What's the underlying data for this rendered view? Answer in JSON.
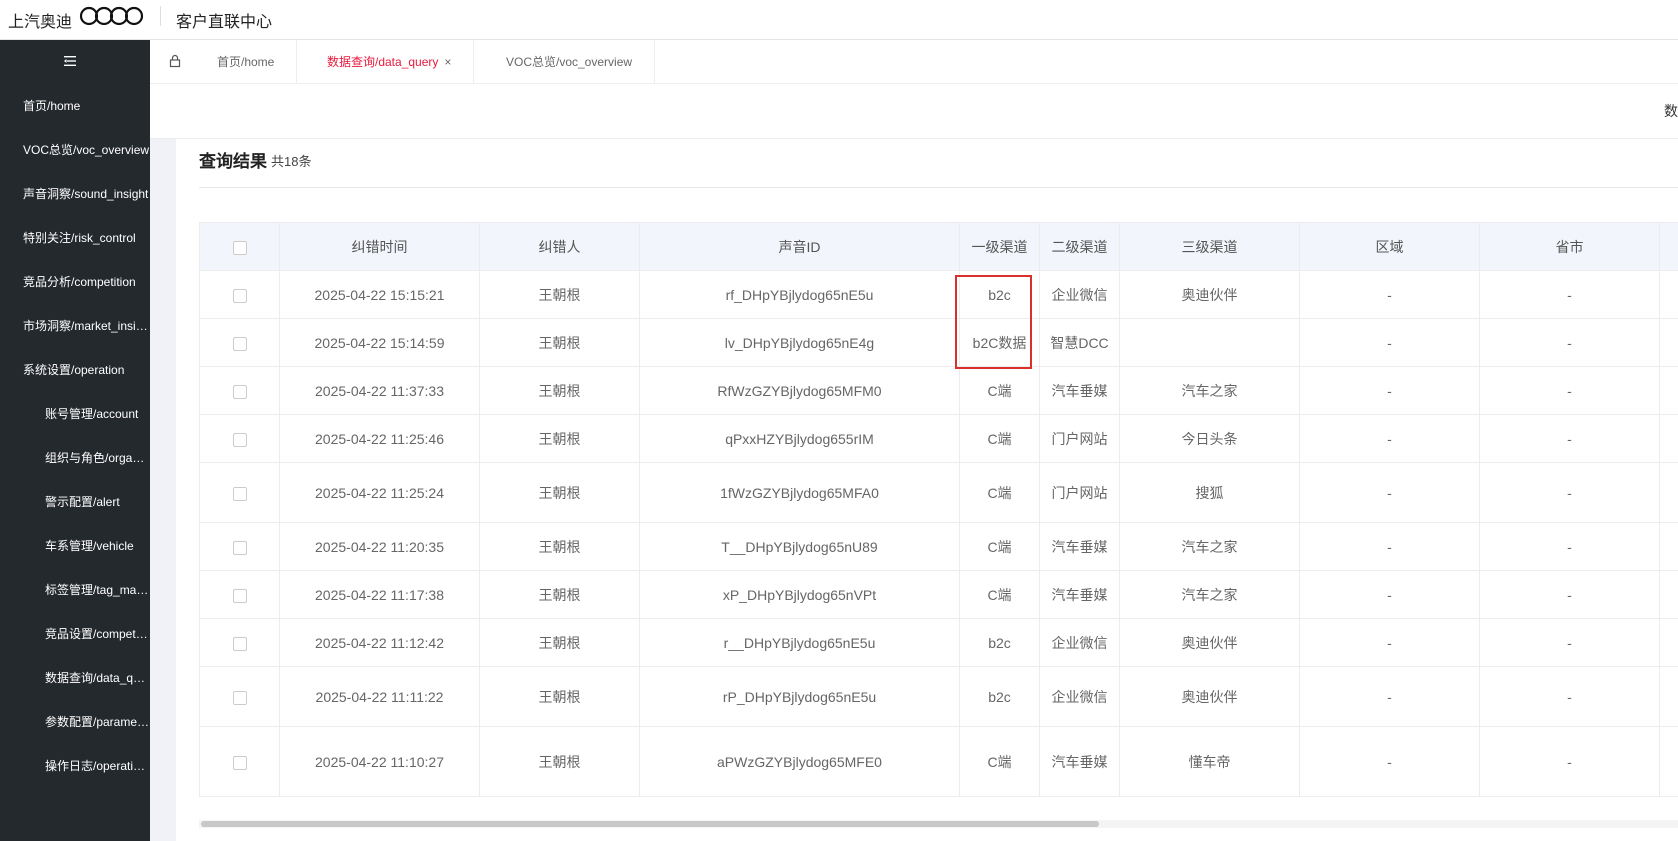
{
  "header": {
    "brand": "上汽奥迪",
    "system_title": "客户直联中心",
    "icons": {
      "logo": "audi-rings-logo",
      "menu": "hamburger-menu-icon",
      "lock": "lock-icon"
    }
  },
  "sidebar": {
    "items": [
      {
        "label": "首页/home"
      },
      {
        "label": "VOC总览/voc_overview"
      },
      {
        "label": "声音洞察/sound_insight"
      },
      {
        "label": "特别关注/risk_control"
      },
      {
        "label": "竞品分析/competition"
      },
      {
        "label": "市场洞察/market_insight"
      },
      {
        "label": "系统设置/operation"
      },
      {
        "label": "账号管理/account"
      },
      {
        "label": "组织与角色/organization"
      },
      {
        "label": "警示配置/alert"
      },
      {
        "label": "车系管理/vehicle"
      },
      {
        "label": "标签管理/tag_manage"
      },
      {
        "label": "竞品设置/competition"
      },
      {
        "label": "数据查询/data_query"
      },
      {
        "label": "参数配置/parameter"
      },
      {
        "label": "操作日志/operation_log"
      }
    ]
  },
  "tabs": [
    {
      "label": "首页/home"
    },
    {
      "label": "数据查询/data_query",
      "close": "×"
    },
    {
      "label": "VOC总览/voc_overview"
    }
  ],
  "filter_cut_text": "数",
  "results": {
    "title": "查询结果",
    "count": "共18条",
    "columns": [
      "纠错时间",
      "纠错人",
      "声音ID",
      "一级渠道",
      "二级渠道",
      "三级渠道",
      "区域",
      "省市"
    ],
    "rows": [
      {
        "time": "2025-04-22 15:15:21",
        "person": "王朝根",
        "voice_id": "rf_DHpYBjlydog65nE5u",
        "ch1": "b2c",
        "ch2": "企业微信",
        "ch3": "奥迪伙伴",
        "region": "-",
        "province": "-"
      },
      {
        "time": "2025-04-22 15:14:59",
        "person": "王朝根",
        "voice_id": "lv_DHpYBjlydog65nE4g",
        "ch1": "b2C数据",
        "ch2": "智慧DCC",
        "ch3": "",
        "region": "-",
        "province": "-"
      },
      {
        "time": "2025-04-22 11:37:33",
        "person": "王朝根",
        "voice_id": "RfWzGZYBjlydog65MFM0",
        "ch1": "C端",
        "ch2": "汽车垂媒",
        "ch3": "汽车之家",
        "region": "-",
        "province": "-"
      },
      {
        "time": "2025-04-22 11:25:46",
        "person": "王朝根",
        "voice_id": "qPxxHZYBjlydog655rIM",
        "ch1": "C端",
        "ch2": "门户网站",
        "ch3": "今日头条",
        "region": "-",
        "province": "-"
      },
      {
        "time": "2025-04-22 11:25:24",
        "person": "王朝根",
        "voice_id": "1fWzGZYBjlydog65MFA0",
        "ch1": "C端",
        "ch2": "门户网站",
        "ch3": "搜狐",
        "region": "-",
        "province": "-"
      },
      {
        "time": "2025-04-22 11:20:35",
        "person": "王朝根",
        "voice_id": "T__DHpYBjlydog65nU89",
        "ch1": "C端",
        "ch2": "汽车垂媒",
        "ch3": "汽车之家",
        "region": "-",
        "province": "-"
      },
      {
        "time": "2025-04-22 11:17:38",
        "person": "王朝根",
        "voice_id": "xP_DHpYBjlydog65nVPt",
        "ch1": "C端",
        "ch2": "汽车垂媒",
        "ch3": "汽车之家",
        "region": "-",
        "province": "-"
      },
      {
        "time": "2025-04-22 11:12:42",
        "person": "王朝根",
        "voice_id": "r__DHpYBjlydog65nE5u",
        "ch1": "b2c",
        "ch2": "企业微信",
        "ch3": "奥迪伙伴",
        "region": "-",
        "province": "-"
      },
      {
        "time": "2025-04-22 11:11:22",
        "person": "王朝根",
        "voice_id": "rP_DHpYBjlydog65nE5u",
        "ch1": "b2c",
        "ch2": "企业微信",
        "ch3": "奥迪伙伴",
        "region": "-",
        "province": "-"
      },
      {
        "time": "2025-04-22 11:10:27",
        "person": "王朝根",
        "voice_id": "aPWzGZYBjlydog65MFE0",
        "ch1": "C端",
        "ch2": "汽车垂媒",
        "ch3": "懂车帝",
        "region": "-",
        "province": "-"
      }
    ]
  },
  "colors": {
    "sidebar_bg": "#24292e",
    "active_tab": "#e8193c",
    "highlight": "#d9302c",
    "header_bg": "#f2f5fb"
  }
}
